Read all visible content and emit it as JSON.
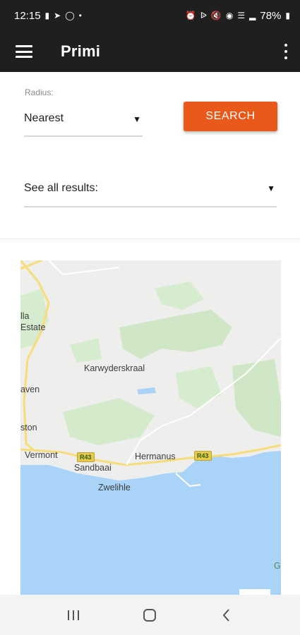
{
  "status_bar": {
    "time": "12:15",
    "battery": "78%",
    "left_icons": [
      "message-icon",
      "telegram-icon",
      "whatsapp-icon",
      "dot-icon"
    ],
    "right_icons": [
      "alarm-icon",
      "bluetooth-icon",
      "mute-icon",
      "location-icon",
      "wifi-icon",
      "signal-icon",
      "battery-icon"
    ]
  },
  "app_bar": {
    "title": "Primi",
    "menu_icon": "hamburger-menu-icon",
    "overflow_icon": "more-vert-icon",
    "background": "#1f1f1f"
  },
  "form": {
    "radius_label": "Radius:",
    "radius_value": "Nearest",
    "search_label": "SEARCH",
    "results_value": "See all results:",
    "accent": "#e8591a"
  },
  "map": {
    "labels": {
      "stella_1": "lla",
      "stella_2": "Estate",
      "haven": "aven",
      "kleinmond": "ston",
      "karwyderskraal": "Karwyderskraal",
      "vermont": "Vermont",
      "sandbaai": "Sandbaai",
      "hermanus": "Hermanus",
      "zwelihle": "Zwelihle",
      "route_1": "R43",
      "route_2": "R43",
      "edge": "G"
    },
    "water_color": "#aad3f8",
    "land_color": "#eeeeec",
    "park_color": "#cce8c4"
  },
  "nav_bar": {
    "icons": [
      "recent-apps-icon",
      "home-icon",
      "back-icon"
    ]
  }
}
